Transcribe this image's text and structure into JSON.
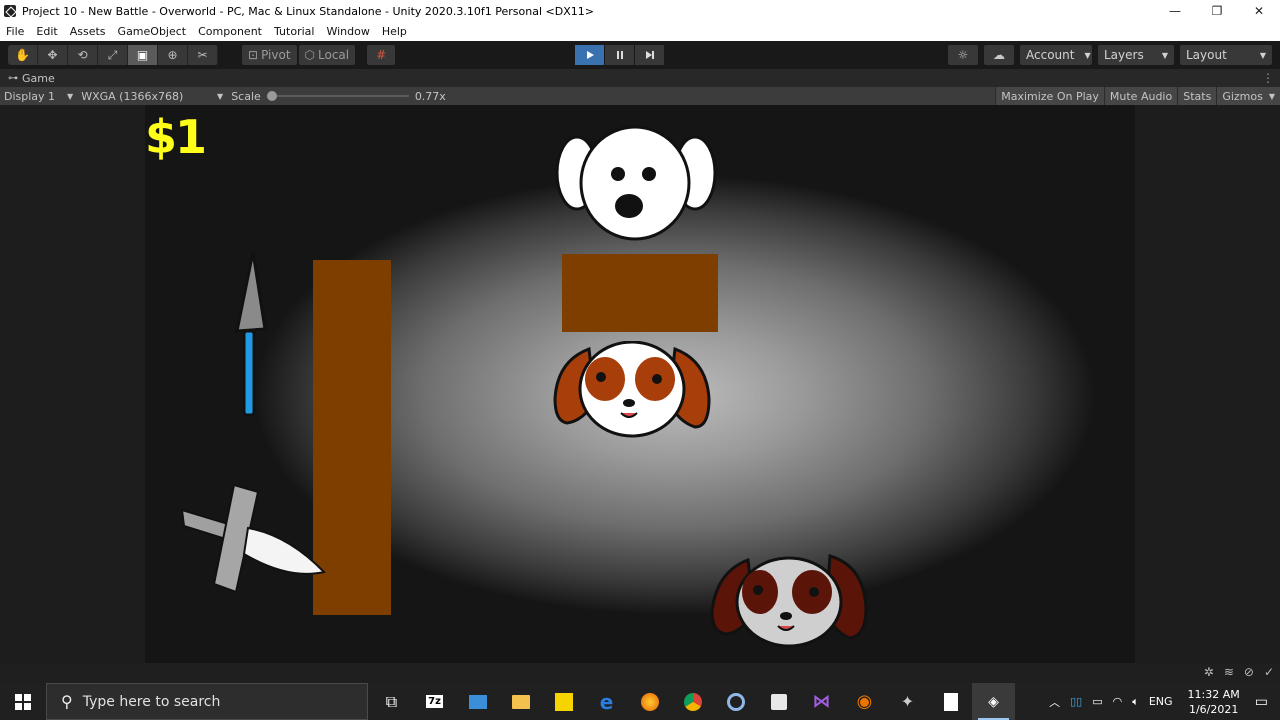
{
  "window": {
    "title": "Project 10 - New Battle - Overworld - PC, Mac & Linux Standalone - Unity 2020.3.10f1 Personal <DX11>",
    "controls": [
      "—",
      "❐",
      "✕"
    ]
  },
  "menu": [
    "File",
    "Edit",
    "Assets",
    "GameObject",
    "Component",
    "Tutorial",
    "Window",
    "Help"
  ],
  "toolbar": {
    "pivot_label": "Pivot",
    "local_label": "Local",
    "account_label": "Account",
    "layers_label": "Layers",
    "layout_label": "Layout",
    "play_active": true
  },
  "game_tab": {
    "label": "Game"
  },
  "game_bar": {
    "display": "Display 1",
    "resolution": "WXGA (1366x768)",
    "scale_label": "Scale",
    "scale_value": "0.77x",
    "maximize_on_play": "Maximize On Play",
    "mute_audio": "Mute Audio",
    "stats": "Stats",
    "gizmos": "Gizmos"
  },
  "game": {
    "money": "$1",
    "wall_color": "#7e3e00",
    "money_color": "#ffff1a"
  },
  "taskbar": {
    "search_placeholder": "Type here to search",
    "language": "ENG",
    "time": "11:32 AM",
    "date": "1/6/2021",
    "apps": [
      "task-view-icon",
      "7zip-icon",
      "control-panel-icon",
      "file-explorer-icon",
      "player-icon",
      "edge-icon",
      "firefox-icon",
      "chrome-icon",
      "cortana-icon",
      "unity-hub-icon",
      "visual-studio-icon",
      "blender-icon",
      "app-icon",
      "file-icon",
      "unity-icon"
    ]
  }
}
